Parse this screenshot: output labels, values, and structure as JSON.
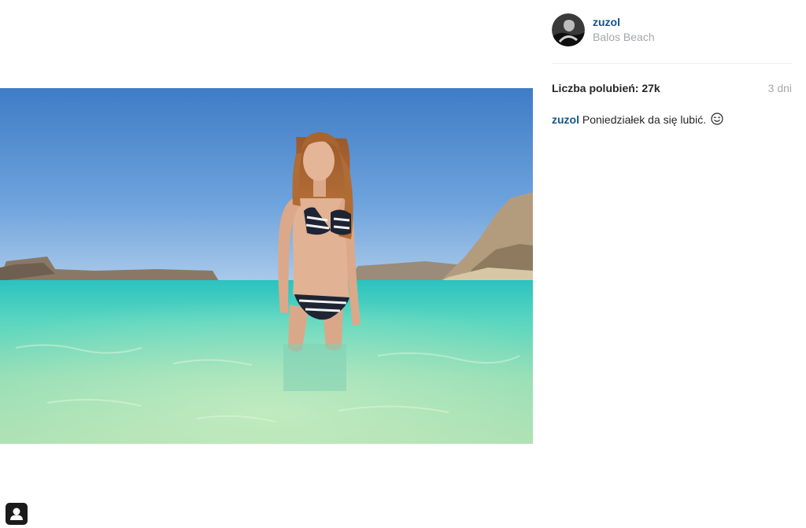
{
  "post": {
    "author": {
      "username": "zuzol",
      "location": "Balos Beach"
    },
    "likes_label": "Liczba polubień: 27k",
    "time_ago": "3 dni",
    "caption": {
      "username": "zuzol",
      "text": "Poniedziałek da się lubić."
    }
  },
  "icons": {
    "caption_emoji": "wink-emoji-icon",
    "tag_badge": "user-tag-icon"
  },
  "colors": {
    "link": "#125688",
    "muted": "#a5a7aa",
    "text": "#262626",
    "divider": "#efefef"
  }
}
